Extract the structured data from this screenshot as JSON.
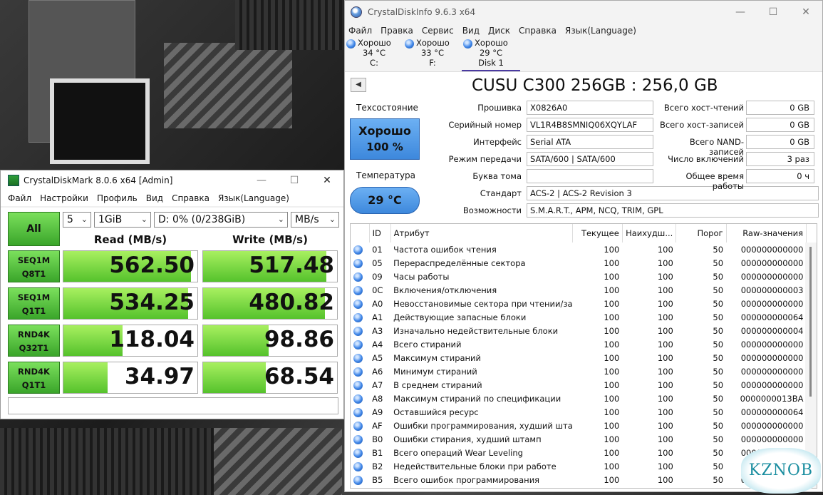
{
  "cdi": {
    "title": "CrystalDiskInfo 9.6.3 x64",
    "menu": [
      "Файл",
      "Правка",
      "Сервис",
      "Вид",
      "Диск",
      "Справка",
      "Язык(Language)"
    ],
    "disks": [
      {
        "status": "Хорошо",
        "temp": "34 °C",
        "name": "C:"
      },
      {
        "status": "Хорошо",
        "temp": "33 °C",
        "name": "F:"
      },
      {
        "status": "Хорошо",
        "temp": "29 °C",
        "name": "Disk 1"
      }
    ],
    "model": "CUSU C300 256GB : 256,0 GB",
    "health_label": "Техсостояние",
    "health_status": "Хорошо",
    "health_percent": "100 %",
    "temp_label": "Температура",
    "temp_value": "29 °C",
    "info": [
      {
        "label": "Прошивка",
        "value": "X0826A0"
      },
      {
        "label": "Серийный номер",
        "value": "VL1R4B8SMNIQ06XQYLAF"
      },
      {
        "label": "Интерфейс",
        "value": "Serial ATA"
      },
      {
        "label": "Режим передачи",
        "value": "SATA/600 | SATA/600"
      },
      {
        "label": "Буква тома",
        "value": ""
      },
      {
        "label": "Стандарт",
        "value": "ACS-2 | ACS-2 Revision 3"
      },
      {
        "label": "Возможности",
        "value": "S.M.A.R.T., APM, NCQ, TRIM, GPL"
      }
    ],
    "info_right": [
      {
        "label": "Всего хост-чтений",
        "value": "0 GB"
      },
      {
        "label": "Всего хост-записей",
        "value": "0 GB"
      },
      {
        "label": "Всего NAND-записей",
        "value": "0 GB"
      },
      {
        "label": "Число включений",
        "value": "3 раз"
      },
      {
        "label": "Общее время работы",
        "value": "0 ч"
      }
    ],
    "smart_headers": [
      "ID",
      "Атрибут",
      "Текущее",
      "Наихудш...",
      "Порог",
      "Raw-значения"
    ],
    "smart_rows": [
      [
        "01",
        "Частота ошибок чтения",
        "100",
        "100",
        "50",
        "000000000000"
      ],
      [
        "05",
        "Перераспределённые сектора",
        "100",
        "100",
        "50",
        "000000000000"
      ],
      [
        "09",
        "Часы работы",
        "100",
        "100",
        "50",
        "000000000000"
      ],
      [
        "0C",
        "Включения/отключения",
        "100",
        "100",
        "50",
        "000000000003"
      ],
      [
        "A0",
        "Невосстановимые сектора при чтении/за...",
        "100",
        "100",
        "50",
        "000000000000"
      ],
      [
        "A1",
        "Действующие запасные блоки",
        "100",
        "100",
        "50",
        "000000000064"
      ],
      [
        "A3",
        "Изначально недействительные блоки",
        "100",
        "100",
        "50",
        "000000000004"
      ],
      [
        "A4",
        "Всего стираний",
        "100",
        "100",
        "50",
        "000000000000"
      ],
      [
        "A5",
        "Максимум стираний",
        "100",
        "100",
        "50",
        "000000000000"
      ],
      [
        "A6",
        "Минимум стираний",
        "100",
        "100",
        "50",
        "000000000000"
      ],
      [
        "A7",
        "В среднем стираний",
        "100",
        "100",
        "50",
        "000000000000"
      ],
      [
        "A8",
        "Максимум стираний по спецификации",
        "100",
        "100",
        "50",
        "0000000013BA"
      ],
      [
        "A9",
        "Оставшийся ресурс",
        "100",
        "100",
        "50",
        "000000000064"
      ],
      [
        "AF",
        "Ошибки программирования, худший шта...",
        "100",
        "100",
        "50",
        "000000000000"
      ],
      [
        "B0",
        "Ошибки стирания, худший штамп",
        "100",
        "100",
        "50",
        "000000000000"
      ],
      [
        "B1",
        "Всего операций Wear Leveling",
        "100",
        "100",
        "50",
        "000000000000"
      ],
      [
        "B2",
        "Недействительные блоки при работе",
        "100",
        "100",
        "50",
        "000000000000"
      ],
      [
        "B5",
        "Всего ошибок программирования",
        "100",
        "100",
        "50",
        "000000000000"
      ]
    ]
  },
  "cdm": {
    "title": "CrystalDiskMark 8.0.6 x64 [Admin]",
    "menu": [
      "Файл",
      "Настройки",
      "Профиль",
      "Вид",
      "Справка",
      "Язык(Language)"
    ],
    "all_label": "All",
    "count": "5",
    "size": "1GiB",
    "drive": "D: 0% (0/238GiB)",
    "unit": "MB/s",
    "read_header": "Read (MB/s)",
    "write_header": "Write (MB/s)",
    "tests": [
      {
        "l1": "SEQ1M",
        "l2": "Q8T1",
        "read": "562.50",
        "write": "517.48",
        "read_fill": 0.95,
        "write_fill": 0.92
      },
      {
        "l1": "SEQ1M",
        "l2": "Q1T1",
        "read": "534.25",
        "write": "480.82",
        "read_fill": 0.93,
        "write_fill": 0.91
      },
      {
        "l1": "RND4K",
        "l2": "Q32T1",
        "read": "118.04",
        "write": "98.86",
        "read_fill": 0.44,
        "write_fill": 0.49
      },
      {
        "l1": "RND4K",
        "l2": "Q1T1",
        "read": "34.97",
        "write": "68.54",
        "read_fill": 0.33,
        "write_fill": 0.47
      }
    ]
  },
  "watermark": "KZNOB"
}
